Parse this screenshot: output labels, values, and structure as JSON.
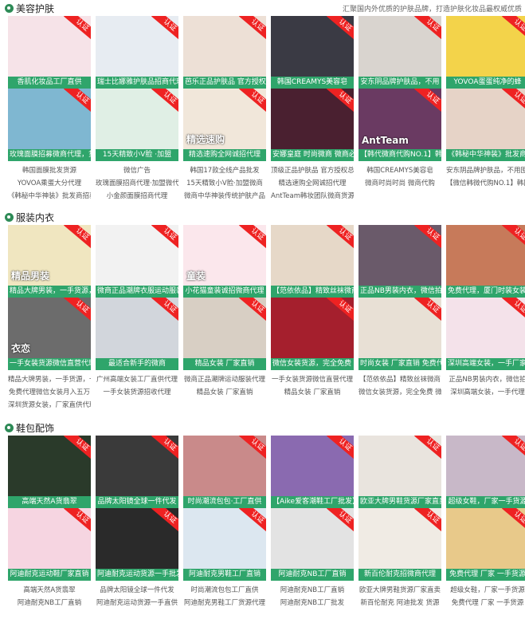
{
  "colors": {
    "caption_bg": "#2fa56b",
    "badge_bg": "#ee2222",
    "section_icon": "#2e8b57"
  },
  "badge_label": "认证",
  "sections": [
    {
      "title": "美容护肤",
      "tagline": "汇聚国内外优质的护肤品牌，打造护肤化妆品最权威优质",
      "tiles": [
        {
          "caption": "香肌化妆品工厂直供",
          "overlay": "",
          "bg": "#f6e3e8"
        },
        {
          "caption": "瑞士比娜雅护肤品招商代理",
          "overlay": "",
          "bg": "#e7ecf2"
        },
        {
          "caption": "芭乐正品护肤品 官方授权总代",
          "overlay": "",
          "bg": "#ede0d6"
        },
        {
          "caption": "韩国CREAMYS美容皂",
          "overlay": "",
          "bg": "#3a3a44"
        },
        {
          "caption": "安东阴品牌护肤品，不用",
          "overlay": "",
          "bg": "#d9d4cf"
        },
        {
          "caption": "YOVOA蛋蛋纯净的蜂",
          "overlay": "",
          "bg": "#f3d34a"
        },
        {
          "caption": "玫瑰面膜招募微商代理，货源",
          "overlay": "",
          "bg": "#7fb7d1"
        },
        {
          "caption": "15天精致小V脸 ·加盟",
          "overlay": "",
          "bg": "#e0efe5"
        },
        {
          "caption": "精选速购全网诚招代理",
          "overlay": "精选速购",
          "bg": "#f1e7da"
        },
        {
          "caption": "安娜皇庭 时尚微商 微商必选产",
          "overlay": "",
          "bg": "#4a2030"
        },
        {
          "caption": "【韩代微商代购NO.1】韩国",
          "overlay": "AntTeam",
          "bg": "#6a3a62"
        },
        {
          "caption": "《韩秘中华神装》批发商招",
          "overlay": "",
          "bg": "#e6d3c7"
        }
      ],
      "links": [
        [
          "韩国面膜批发货源",
          "YOVOA乘蛋大分代理",
          "《韩秘中华神装》批发商招募"
        ],
        [
          "微信广告",
          "玫瑰面膜招商代理·加盟微代",
          "小金颜面膜招商代理"
        ],
        [
          "韩国17款全线产品批发",
          "15天精致小V脸·加盟微商",
          "微商中华神装传统护肤产品"
        ],
        [
          "顶级正品护肤品 官方授权总代",
          "精选速购全网诚招代理",
          "AntTeam韩妆团队微商货源"
        ],
        [
          "韩国CREAMYS美容皂",
          "微商时尚时尚 微商代购",
          ""
        ],
        [
          "安东阴品牌护肤品，不用囤货",
          "【微信韩微代购NO.1】韩国",
          ""
        ]
      ]
    },
    {
      "title": "服装内衣",
      "tagline": "",
      "tiles": [
        {
          "caption": "精品大牌男装，一手货源，一件",
          "overlay": "精品男装",
          "bg": "#f0e6c0"
        },
        {
          "caption": "微商正品潮牌衣服运动服装",
          "overlay": "",
          "bg": "#f2f2f2"
        },
        {
          "caption": "小花猫童装诚招微商代理",
          "overlay": "童装",
          "bg": "#fbe7ec"
        },
        {
          "caption": "【范依依品】精致丝袜微商",
          "overlay": "",
          "bg": "#e6d8c8"
        },
        {
          "caption": "正品NB男装内衣，微信拍",
          "overlay": "",
          "bg": "#6a5a6a"
        },
        {
          "caption": "免费代理，厦门时装女装诚招代",
          "overlay": "",
          "bg": "#c77a5a"
        },
        {
          "caption": "一手女装货源微信直营代理",
          "overlay": "衣恋",
          "bg": "#6c6c6c"
        },
        {
          "caption": "最适合新手的微商",
          "overlay": "",
          "bg": "#d2d6dc"
        },
        {
          "caption": "精品女装 厂家直销",
          "overlay": "",
          "bg": "#d8cfc4"
        },
        {
          "caption": "微信女装货源，完全免费 微信",
          "overlay": "",
          "bg": "#a51f2d"
        },
        {
          "caption": "时尚女装 厂家直销 免费代理",
          "overlay": "",
          "bg": "#e8e0d5"
        },
        {
          "caption": "深圳高端女装，一手厂家代理",
          "overlay": "",
          "bg": "#f4e2ea"
        }
      ],
      "links": [
        [
          "精品大牌男装，一手货源，一件",
          "免费代理微信女装月入五万",
          "深圳货源女装，厂家直供代理"
        ],
        [
          "广州高端女装工厂直供代理",
          "一手女装货源招收代理",
          ""
        ],
        [
          "微商正品潮牌运动服装代理",
          "精品女装 厂家直销",
          ""
        ],
        [
          "一手女装货源微信直营代理",
          "精品女装 厂家直销",
          ""
        ],
        [
          "【范依依品】精致丝袜微商",
          "微信女装货源，完全免费 微信",
          ""
        ],
        [
          "正品NB男装内衣，微信拍",
          "深圳高端女装，一手代理",
          ""
        ]
      ]
    },
    {
      "title": "鞋包配饰",
      "tagline": "",
      "tiles": [
        {
          "caption": "高端天然A货翡翠",
          "overlay": "",
          "bg": "#2a3a2a"
        },
        {
          "caption": "品牌太阳镜全球一件代发",
          "overlay": "",
          "bg": "#3a3a3a"
        },
        {
          "caption": "时尚潮流包包·工厂直供",
          "overlay": "",
          "bg": "#c98a8a"
        },
        {
          "caption": "【Aike爱客潮鞋工厂批发】",
          "overlay": "",
          "bg": "#8a6ab0"
        },
        {
          "caption": "欧亚大牌男鞋货源厂家直卖",
          "overlay": "",
          "bg": "#e9e4de"
        },
        {
          "caption": "超级女鞋，厂家一手货源",
          "overlay": "",
          "bg": "#c8b8c8"
        },
        {
          "caption": "阿迪耐克运动鞋厂家直销",
          "overlay": "",
          "bg": "#f6d5e1"
        },
        {
          "caption": "阿迪耐克运动货源一手批发",
          "overlay": "",
          "bg": "#2a2a2a"
        },
        {
          "caption": "阿迪耐克男鞋工厂直销",
          "overlay": "",
          "bg": "#dce7f0"
        },
        {
          "caption": "阿迪耐克NB工厂直销",
          "overlay": "",
          "bg": "#e3e3e3"
        },
        {
          "caption": "新百伦耐克招微商代理",
          "overlay": "",
          "bg": "#f0ebe4"
        },
        {
          "caption": "免费代理 厂家 一手货源",
          "overlay": "",
          "bg": "#e8c98a"
        }
      ],
      "links": [
        [
          "高端天然A货翡翠",
          "阿迪耐克NB工厂直销"
        ],
        [
          "品牌太阳镜全球一件代发",
          "阿迪耐克运动货源一手直供"
        ],
        [
          "时尚潮流包包工厂直供",
          "阿迪耐克男鞋工厂货源代理"
        ],
        [
          "阿迪耐克NB工厂直销",
          "阿迪耐克NB工厂批发"
        ],
        [
          "欧亚大牌男鞋货源厂家直卖",
          "新百伦耐克 阿迪批发 货源"
        ],
        [
          "超级女鞋，厂家一手货源",
          "免费代理 厂家 一手货源"
        ]
      ]
    }
  ]
}
